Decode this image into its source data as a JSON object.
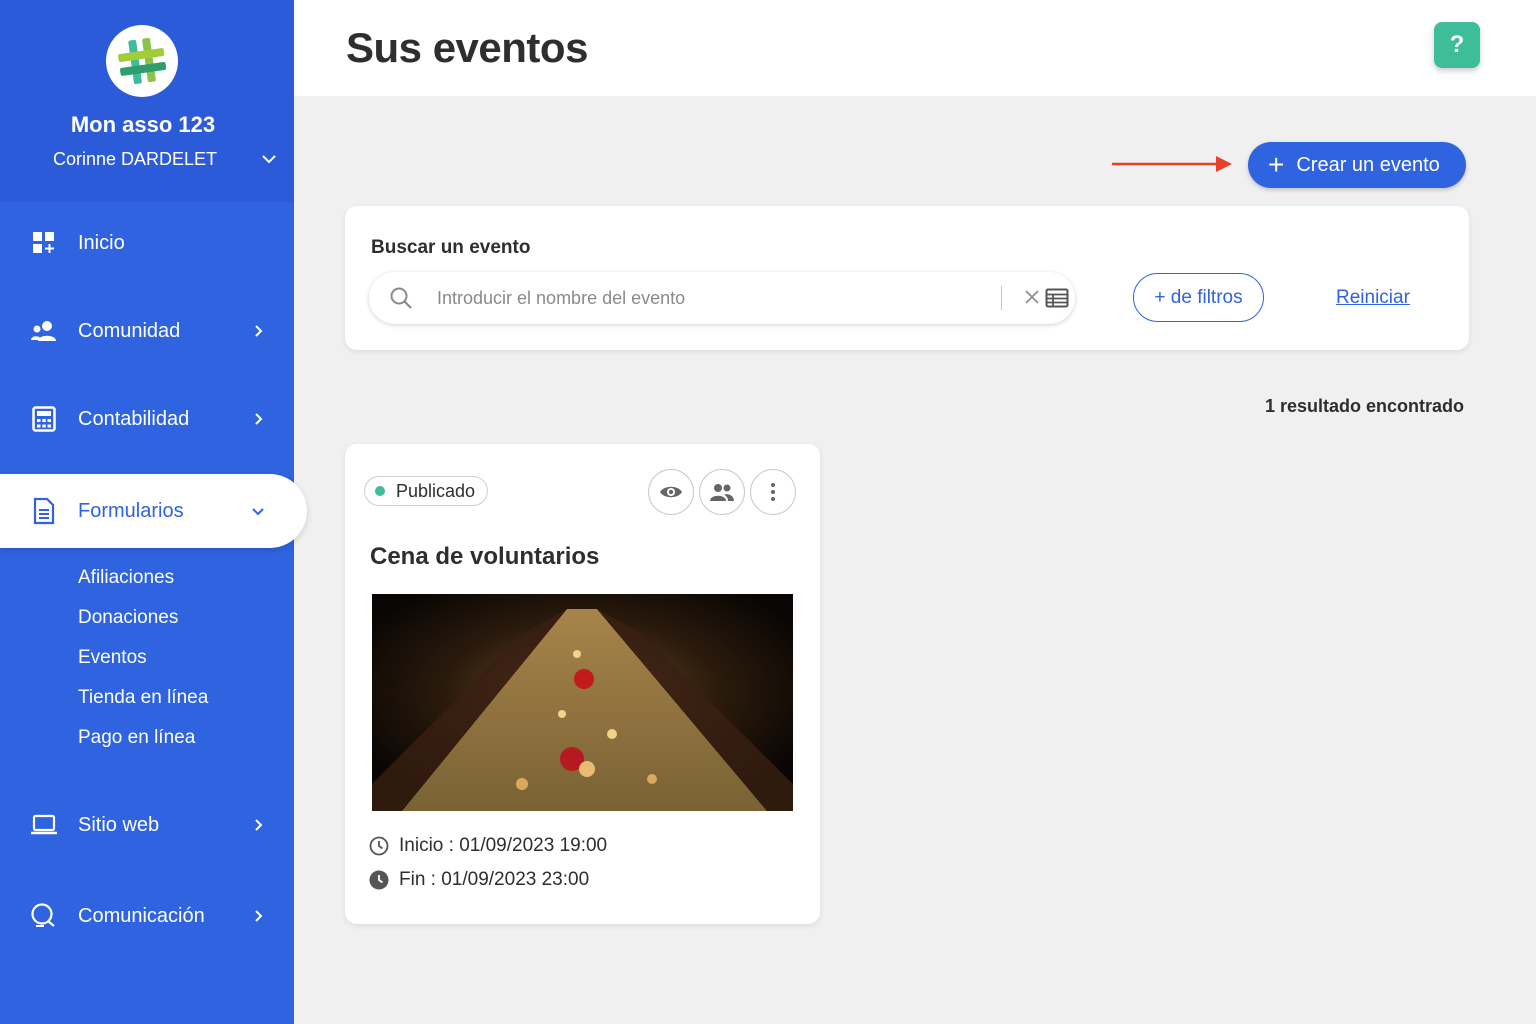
{
  "sidebar": {
    "org_name": "Mon asso 123",
    "user_name": "Corinne DARDELET",
    "items": [
      {
        "label": "Inicio",
        "icon": "dashboard-icon"
      },
      {
        "label": "Comunidad",
        "icon": "users-icon"
      },
      {
        "label": "Contabilidad",
        "icon": "calculator-icon"
      },
      {
        "label": "Formularios",
        "icon": "document-icon",
        "active": true
      },
      {
        "label": "Sitio web",
        "icon": "laptop-icon"
      },
      {
        "label": "Comunicación",
        "icon": "chat-icon"
      }
    ],
    "subitems": [
      "Afiliaciones",
      "Donaciones",
      "Eventos",
      "Tienda en línea",
      "Pago en línea"
    ]
  },
  "header": {
    "title": "Sus eventos",
    "help_label": "?"
  },
  "main": {
    "create_button": "Crear un evento",
    "search": {
      "label": "Buscar un evento",
      "placeholder": "Introducir el nombre del evento",
      "value": "",
      "filters_button": "+ de filtros",
      "reset_link": "Reiniciar"
    },
    "results_count": "1 resultado encontrado",
    "event": {
      "status": "Publicado",
      "title": "Cena de voluntarios",
      "start": "Inicio : 01/09/2023 19:00",
      "end": "Fin : 01/09/2023 23:00"
    }
  },
  "colors": {
    "primary": "#2f63e0",
    "sidebar": "#2f63e0",
    "help": "#3dbd9a",
    "status_published": "#3dbd9a",
    "arrow": "#e8402a"
  }
}
